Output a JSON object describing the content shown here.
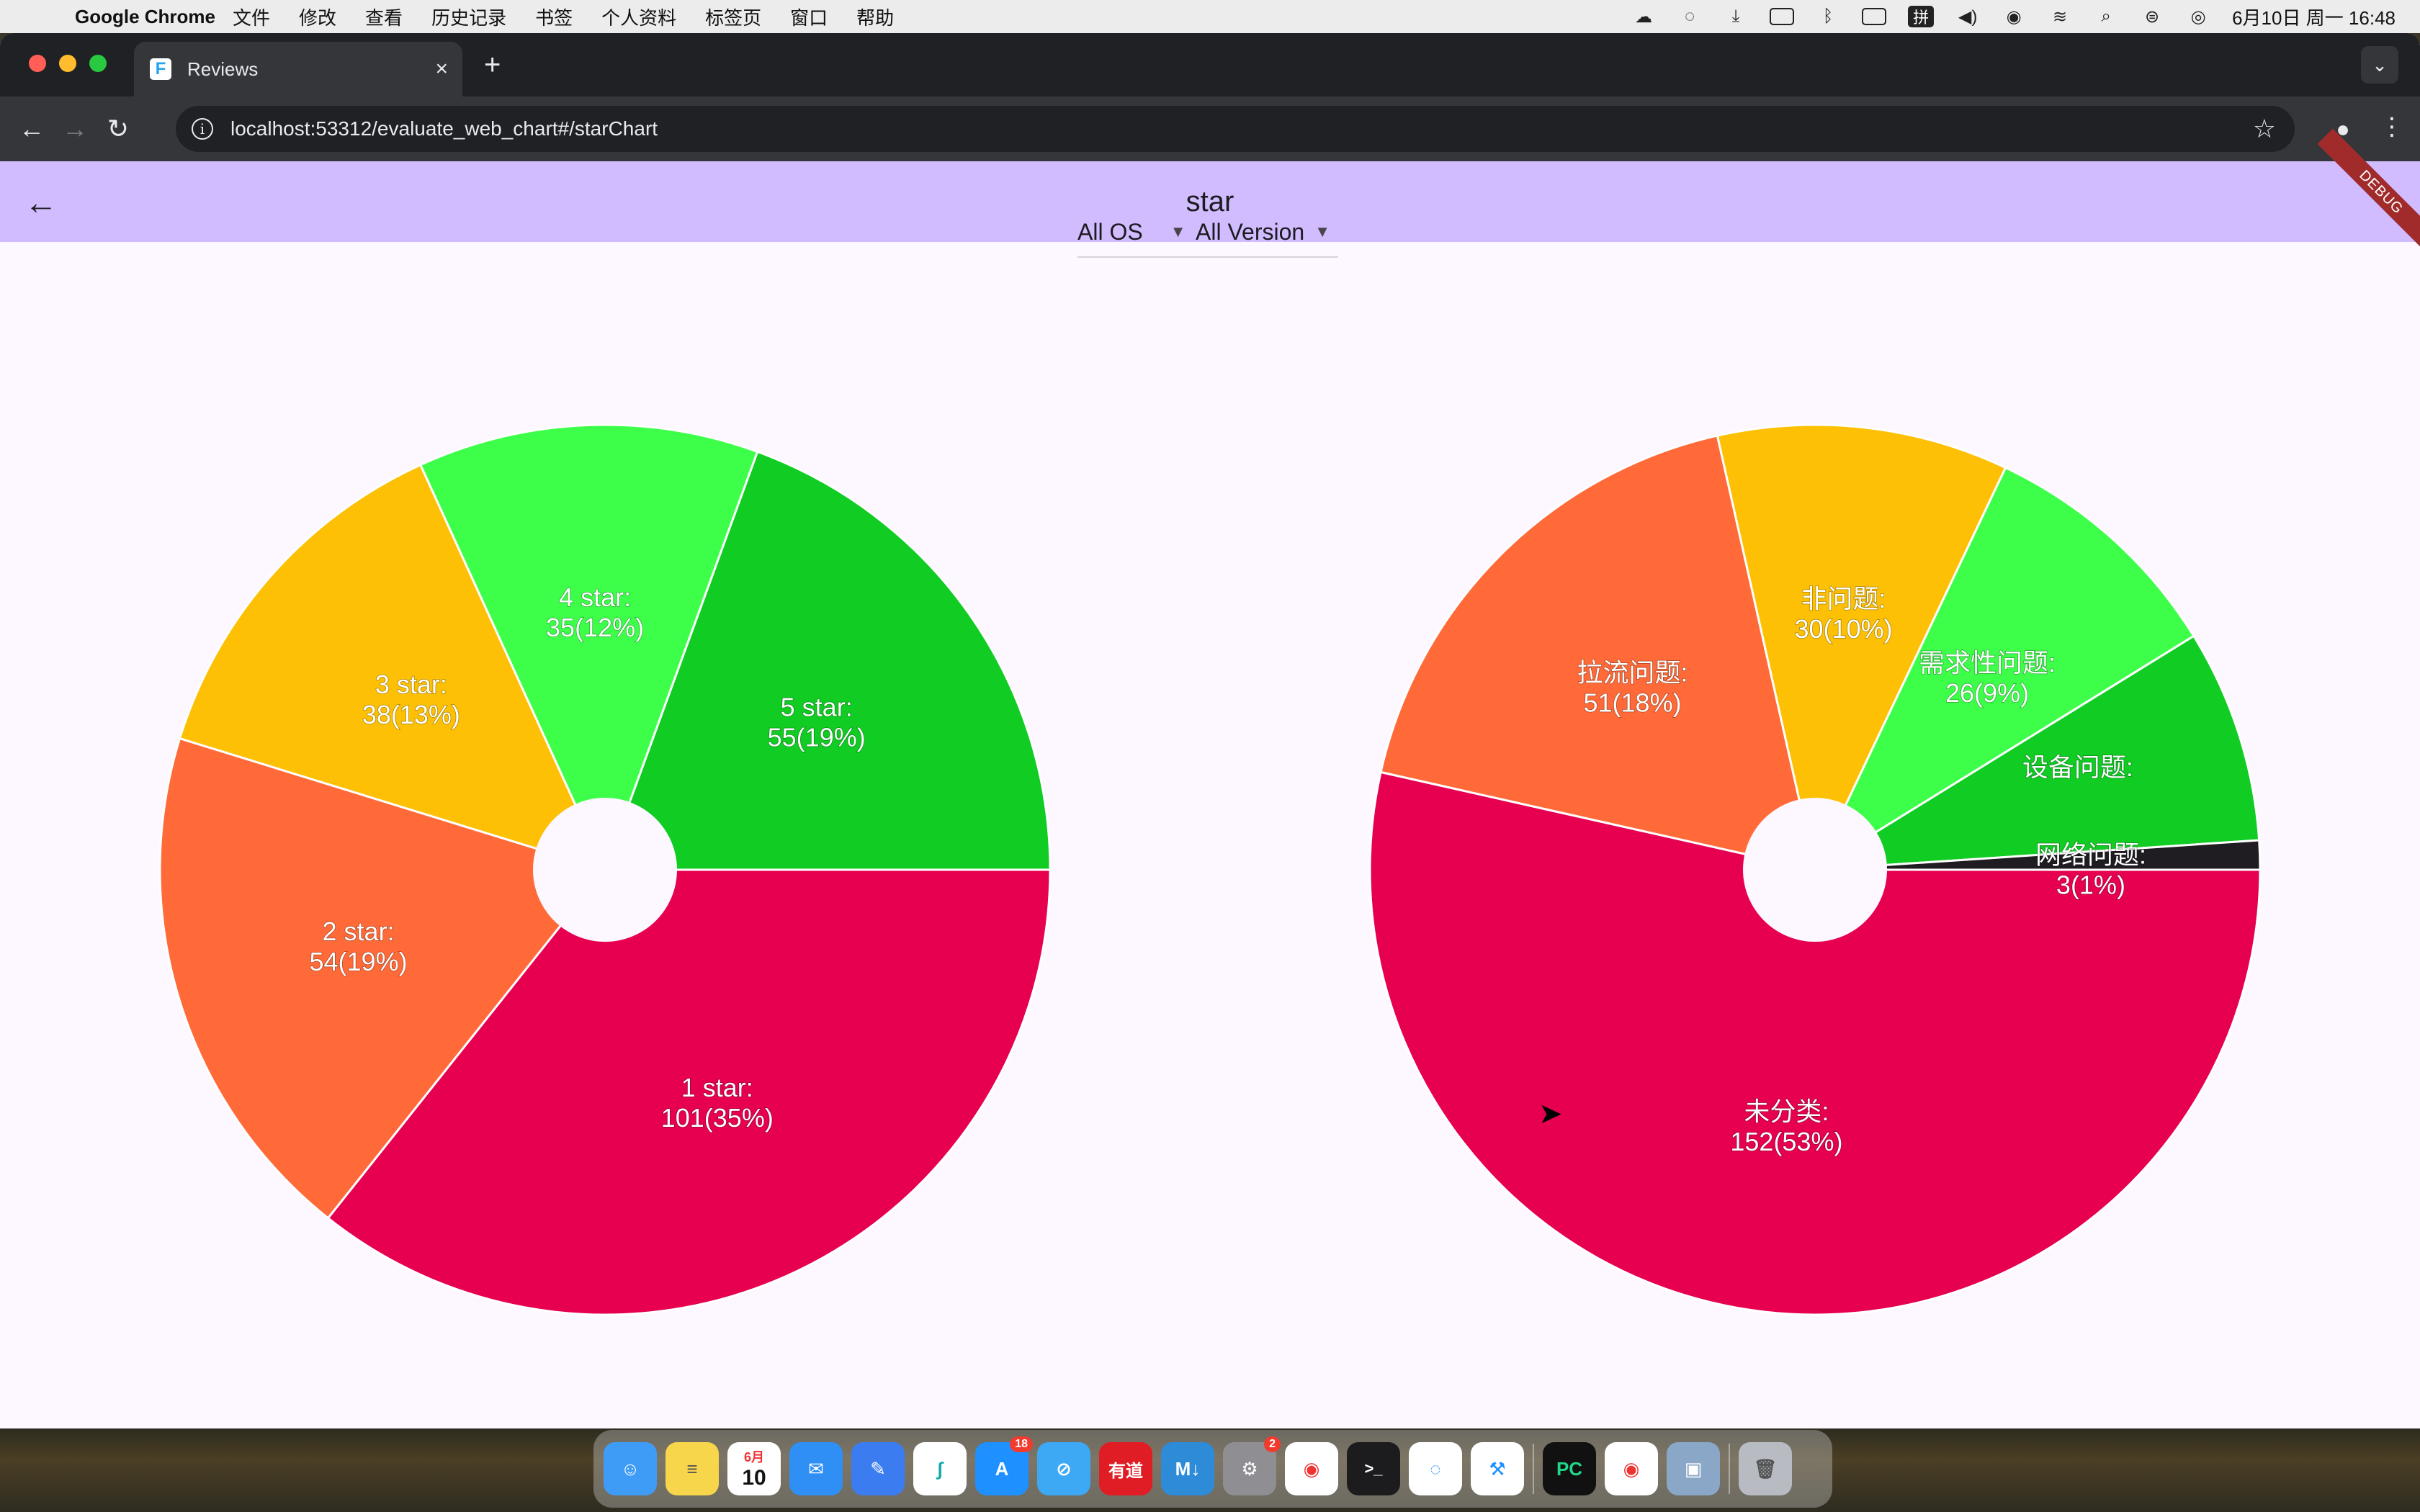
{
  "menubar": {
    "app_name": "Google Chrome",
    "items": [
      "文件",
      "修改",
      "查看",
      "历史记录",
      "书签",
      "个人资料",
      "标签页",
      "窗口",
      "帮助"
    ],
    "input_method": "拼",
    "clock": "6月10日 周一  16:48"
  },
  "browser": {
    "tab_title": "Reviews",
    "url": "localhost:53312/evaluate_web_chart#/starChart"
  },
  "appbar": {
    "title": "star",
    "debug_label": "DEBUG",
    "color": "#d0bcff"
  },
  "filters": {
    "os": "All OS",
    "version": "All Version"
  },
  "chart_data": [
    {
      "type": "pie",
      "donut_hole": true,
      "slices": [
        {
          "label": "1 star:",
          "value_label": "101(35%)",
          "value": 101,
          "percent": 35,
          "color": "#e6004f"
        },
        {
          "label": "2 star:",
          "value_label": "54(19%)",
          "value": 54,
          "percent": 19,
          "color": "#ff6a38"
        },
        {
          "label": "3 star:",
          "value_label": "38(13%)",
          "value": 38,
          "percent": 13,
          "color": "#fdc005"
        },
        {
          "label": "4 star:",
          "value_label": "35(12%)",
          "value": 35,
          "percent": 12,
          "color": "#3dff4a"
        },
        {
          "label": "5 star:",
          "value_label": "55(19%)",
          "value": 55,
          "percent": 19,
          "color": "#10cc23"
        }
      ]
    },
    {
      "type": "pie",
      "donut_hole": true,
      "slices": [
        {
          "label": "未分类:",
          "value_label": "152(53%)",
          "value": 152,
          "percent": 53,
          "color": "#e6004f"
        },
        {
          "label": "拉流问题:",
          "value_label": "51(18%)",
          "value": 51,
          "percent": 18,
          "color": "#ff6a38"
        },
        {
          "label": "非问题:",
          "value_label": "30(10%)",
          "value": 30,
          "percent": 10,
          "color": "#fdc005"
        },
        {
          "label": "需求性问题:",
          "value_label": "26(9%)",
          "value": 26,
          "percent": 9,
          "color": "#3dff4a"
        },
        {
          "label": "设备问题:",
          "value_label": "",
          "value": 22,
          "percent": 8,
          "color": "#10cc23"
        },
        {
          "label": "网络问题:",
          "value_label": "3(1%)",
          "value": 3,
          "percent": 1,
          "color": "#1f1d22"
        }
      ]
    }
  ],
  "dock": {
    "calendar_month": "6月",
    "calendar_day": "10",
    "appstore_badge": "18",
    "settings_badge": "2",
    "youdao_label": "有道",
    "markdown_label": "M↓",
    "terminal_label": ">_",
    "pycharm_label": "PC"
  }
}
